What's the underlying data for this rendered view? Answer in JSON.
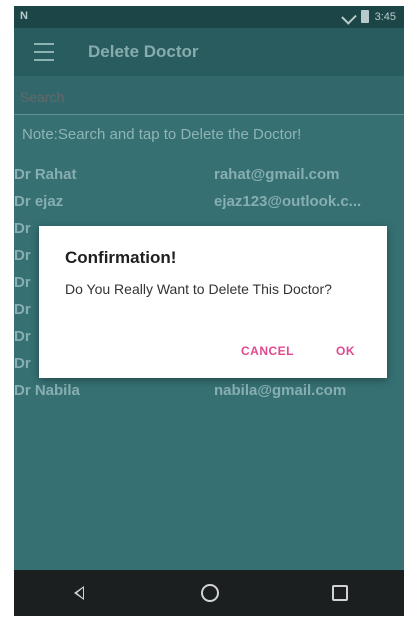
{
  "status_bar": {
    "left_text": "N",
    "time": "3:45"
  },
  "app_bar": {
    "title": "Delete Doctor",
    "menu_icon": "hamburger-menu-icon"
  },
  "search": {
    "placeholder": "Search"
  },
  "note": "Note:Search and tap to Delete the Doctor!",
  "doctors": [
    {
      "name": "Dr Rahat",
      "email": "rahat@gmail.com"
    },
    {
      "name": "Dr ejaz",
      "email": "ejaz123@outlook.c..."
    },
    {
      "name": "Dr",
      "email": ""
    },
    {
      "name": "Dr",
      "email": ""
    },
    {
      "name": "Dr",
      "email": ""
    },
    {
      "name": "Dr",
      "email": ""
    },
    {
      "name": "Dr",
      "email": ""
    },
    {
      "name": "Dr",
      "email": ""
    },
    {
      "name": "Dr Nabila",
      "email": "nabila@gmail.com"
    }
  ],
  "dialog": {
    "title": "Confirmation!",
    "message": "Do You Really Want to Delete This Doctor?",
    "cancel_label": "CANCEL",
    "ok_label": "OK"
  },
  "nav_bar": {
    "back_icon": "back-triangle-icon",
    "home_icon": "home-circle-icon",
    "recent_icon": "recent-apps-square-icon"
  },
  "colors": {
    "background": "#3f7d80",
    "app_bar": "#2f6569",
    "accent": "#e0488f",
    "nav_bar": "#1c1f1f"
  }
}
